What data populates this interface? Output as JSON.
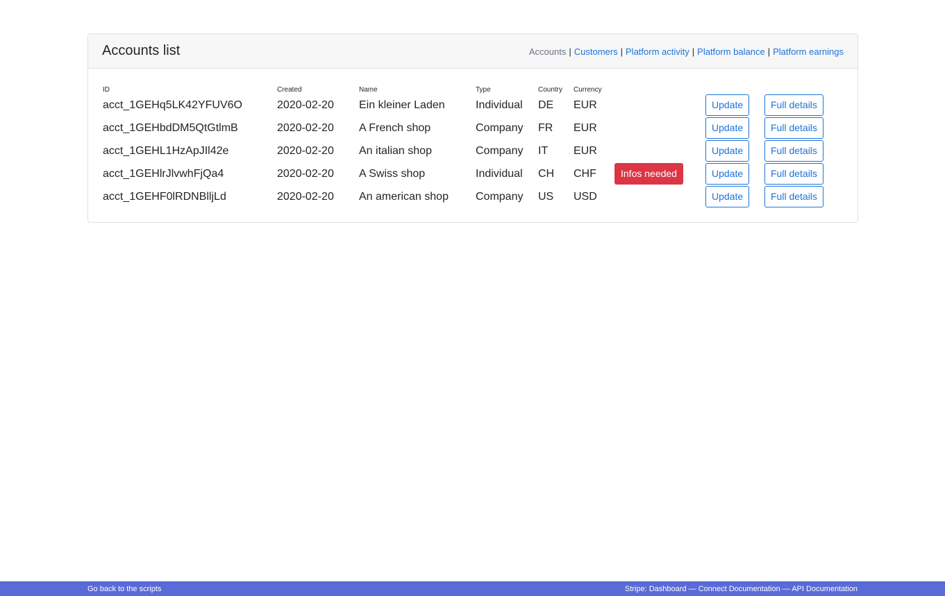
{
  "card": {
    "title": "Accounts list",
    "nav": {
      "current": "Accounts",
      "separator": "|",
      "links": [
        "Customers",
        "Platform activity",
        "Platform balance",
        "Platform earnings"
      ]
    }
  },
  "table": {
    "headers": [
      "ID",
      "Created",
      "Name",
      "Type",
      "Country",
      "Currency"
    ],
    "update_label": "Update",
    "details_label": "Full details",
    "rows": [
      {
        "id": "acct_1GEHq5LK42YFUV6O",
        "created": "2020-02-20",
        "name": "Ein kleiner Laden",
        "type": "Individual",
        "country": "DE",
        "currency": "EUR",
        "status": ""
      },
      {
        "id": "acct_1GEHbdDM5QtGtlmB",
        "created": "2020-02-20",
        "name": "A French shop",
        "type": "Company",
        "country": "FR",
        "currency": "EUR",
        "status": ""
      },
      {
        "id": "acct_1GEHL1HzApJIl42e",
        "created": "2020-02-20",
        "name": "An italian shop",
        "type": "Company",
        "country": "IT",
        "currency": "EUR",
        "status": ""
      },
      {
        "id": "acct_1GEHlrJlvwhFjQa4",
        "created": "2020-02-20",
        "name": "A Swiss shop",
        "type": "Individual",
        "country": "CH",
        "currency": "CHF",
        "status": "Infos needed"
      },
      {
        "id": "acct_1GEHF0lRDNBlljLd",
        "created": "2020-02-20",
        "name": "An american shop",
        "type": "Company",
        "country": "US",
        "currency": "USD",
        "status": ""
      }
    ]
  },
  "footer": {
    "back_link": "Go back to the scripts",
    "prefix": "Stripe:",
    "links": [
      "Dashboard",
      "Connect Documentation",
      "API Documentation"
    ],
    "separator": "—"
  },
  "colors": {
    "link": "#1a73d9",
    "danger": "#dc3545",
    "footer_bg": "#5a6bd8"
  }
}
